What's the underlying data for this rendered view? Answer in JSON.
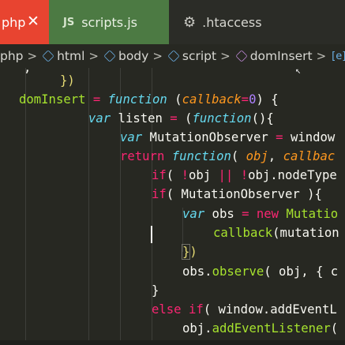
{
  "tabs": [
    {
      "label": "php",
      "close": "✕"
    },
    {
      "badge": "JS",
      "label": "scripts.js"
    },
    {
      "icon": "gear-icon",
      "label": ".htaccess"
    }
  ],
  "breadcrumb": {
    "items": [
      "php",
      "html",
      "body",
      "script",
      "domInsert",
      "[e]"
    ],
    "separator": ">"
  },
  "code_lines": [
    {
      "indent": 0,
      "text": "    ,"
    },
    {
      "indent": 0,
      "text": "    })"
    },
    {
      "indent": 0,
      "text": "domInsert = function (callback=0) {"
    },
    {
      "indent": 0,
      "text": "    var listen = (function(){"
    },
    {
      "indent": 0,
      "text": "        var MutationObserver = window"
    },
    {
      "indent": 0,
      "text": "        return function( obj, callbac"
    },
    {
      "indent": 0,
      "text": "            if( !obj || !obj.nodeType"
    },
    {
      "indent": 0,
      "text": "            if( MutationObserver ){"
    },
    {
      "indent": 0,
      "text": "                var obs = new Mutatio"
    },
    {
      "indent": 0,
      "text": "                    callback(mutation"
    },
    {
      "indent": 0,
      "text": "                })"
    },
    {
      "indent": 0,
      "text": "                obs.observe( obj, { c"
    },
    {
      "indent": 0,
      "text": "            }"
    },
    {
      "indent": 0,
      "text": "            else if( window.addEventL"
    },
    {
      "indent": 0,
      "text": "                obj.addEventListener("
    }
  ],
  "colors": {
    "background": "#272822",
    "tab_php": "#e84430",
    "tab_js": "#4c7a43",
    "keyword": "#f92672",
    "storage": "#66d9ef",
    "function": "#a6e22e",
    "param": "#fd971f",
    "number": "#ae81ff"
  }
}
